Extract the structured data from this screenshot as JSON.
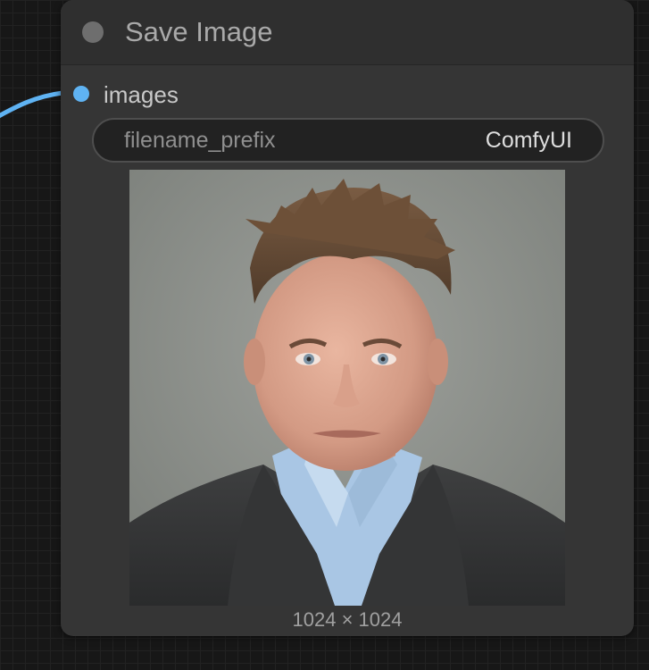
{
  "node": {
    "title": "Save Image",
    "input": {
      "label": "images",
      "color": "#5fb3f3"
    },
    "widget": {
      "name": "filename_prefix",
      "value": "ComfyUI"
    },
    "preview": {
      "size_label": "1024 × 1024"
    }
  },
  "colors": {
    "canvas_bg": "#171717",
    "node_bg": "#353535",
    "link": "#5fb3f3"
  },
  "icons": {
    "collapse": "circle-dot-icon",
    "input_slot": "slot-dot-icon"
  }
}
